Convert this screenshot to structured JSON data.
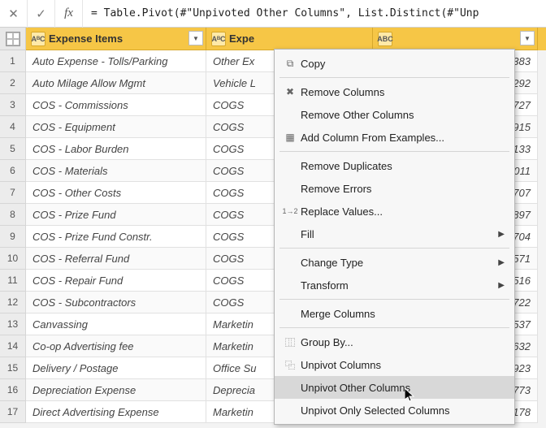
{
  "formula_bar": {
    "fx_label": "fx",
    "formula": "= Table.Pivot(#\"Unpivoted Other Columns\", List.Distinct(#\"Unp"
  },
  "columns": {
    "col1": {
      "type_label": "AᴮC",
      "name": "Expense Items"
    },
    "col2": {
      "type_label": "AᴮC",
      "name": "Expe"
    },
    "col3": {
      "type_label": "ABC",
      "name": ""
    }
  },
  "rows": [
    {
      "n": "1",
      "c1": "Auto Expense - Tolls/Parking",
      "c2": "Other Ex",
      "c3": "94383"
    },
    {
      "n": "2",
      "c1": "Auto Milage Allow Mgmt",
      "c2": "Vehicle L",
      "c3": "05292"
    },
    {
      "n": "3",
      "c1": "COS - Commissions",
      "c2": "COGS",
      "c3": ".6727"
    },
    {
      "n": "4",
      "c1": "COS - Equipment",
      "c2": "COGS",
      "c3": "51915"
    },
    {
      "n": "5",
      "c1": "COS - Labor Burden",
      "c2": "COGS",
      "c3": "38133"
    },
    {
      "n": "6",
      "c1": "COS - Materials",
      "c2": "COGS",
      "c3": "9.011"
    },
    {
      "n": "7",
      "c1": "COS - Other Costs",
      "c2": "COGS",
      "c3": ".4707"
    },
    {
      "n": "8",
      "c1": "COS - Prize Fund",
      "c2": "COGS",
      "c3": ".8897"
    },
    {
      "n": "9",
      "c1": "COS - Prize Fund Constr.",
      "c2": "COGS",
      "c3": ".5704"
    },
    {
      "n": "10",
      "c1": "COS - Referral Fund",
      "c2": "COGS",
      "c3": "13571"
    },
    {
      "n": "11",
      "c1": "COS - Repair Fund",
      "c2": "COGS",
      "c3": "12516"
    },
    {
      "n": "12",
      "c1": "COS - Subcontractors",
      "c2": "COGS",
      "c3": "6.722"
    },
    {
      "n": "13",
      "c1": "Canvassing",
      "c2": "Marketin",
      "c3": ".4537"
    },
    {
      "n": "14",
      "c1": "Co-op Advertising fee",
      "c2": "Marketin",
      "c3": ".6632"
    },
    {
      "n": "15",
      "c1": "Delivery / Postage",
      "c2": "Office Su",
      "c3": "32923"
    },
    {
      "n": "16",
      "c1": "Depreciation Expense",
      "c2": "Deprecia",
      "c3": "1.773"
    },
    {
      "n": "17",
      "c1": "Direct Advertising Expense",
      "c2": "Marketin",
      "c3": ".9178"
    }
  ],
  "context_menu": {
    "items": [
      {
        "icon": "copy-icon",
        "label": "Copy",
        "sub": false
      },
      {
        "sep": true
      },
      {
        "icon": "remove-col-icon",
        "label": "Remove Columns",
        "sub": false
      },
      {
        "icon": "",
        "label": "Remove Other Columns",
        "sub": false
      },
      {
        "icon": "add-col-icon",
        "label": "Add Column From Examples...",
        "sub": false
      },
      {
        "sep": true
      },
      {
        "icon": "",
        "label": "Remove Duplicates",
        "sub": false
      },
      {
        "icon": "",
        "label": "Remove Errors",
        "sub": false
      },
      {
        "icon": "replace-icon",
        "label": "Replace Values...",
        "sub": false
      },
      {
        "icon": "",
        "label": "Fill",
        "sub": true
      },
      {
        "sep": true
      },
      {
        "icon": "",
        "label": "Change Type",
        "sub": true
      },
      {
        "icon": "",
        "label": "Transform",
        "sub": true
      },
      {
        "sep": true
      },
      {
        "icon": "",
        "label": "Merge Columns",
        "sub": false
      },
      {
        "sep": true
      },
      {
        "icon": "group-icon",
        "label": "Group By...",
        "sub": false
      },
      {
        "icon": "unpivot-icon",
        "label": "Unpivot Columns",
        "sub": false
      },
      {
        "icon": "",
        "label": "Unpivot Other Columns",
        "sub": false,
        "hover": true
      },
      {
        "icon": "",
        "label": "Unpivot Only Selected Columns",
        "sub": false
      }
    ]
  }
}
